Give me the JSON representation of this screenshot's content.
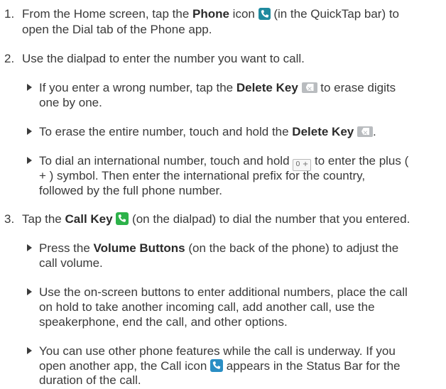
{
  "step1": {
    "num": "1.",
    "l1_a": "From the Home screen, tap the ",
    "l1_b": "Phone",
    "l1_c": " icon ",
    "l1_d": " (in the QuickTap bar) to",
    "l2": "open the Dial tab of the Phone app."
  },
  "step2": {
    "num": "2.",
    "l1": "Use the dialpad to enter the number you want to call.",
    "b1_l1_a": "If you enter a wrong number, tap the ",
    "b1_l1_b": "Delete Key",
    "b1_l1_c": " to erase digits",
    "b1_l2": "one by one.",
    "b2_a": "To erase the entire number, touch and hold the ",
    "b2_b": "Delete Key",
    "b2_c": ".",
    "b3_l1_a": "To dial an international number, touch and hold ",
    "b3_key": "0 +",
    "b3_l1_b": " to enter the plus (",
    "b3_l2": "+ ) symbol. Then enter the international prefix for the country,",
    "b3_l3": "followed by the full phone number."
  },
  "step3": {
    "num": "3.",
    "l1_a": "Tap the ",
    "l1_b": "Call Key",
    "l1_c": " (on the dialpad) to dial the number that you entered.",
    "b1_l1_a": "Press the ",
    "b1_l1_b": "Volume Buttons",
    "b1_l1_c": " (on the back of the phone) to adjust the",
    "b1_l2": "call volume.",
    "b2_l1": "Use the on-screen buttons to enter additional numbers, place the call",
    "b2_l2": "on hold to take another incoming call, add another call, use the",
    "b2_l3": "speakerphone, end the call, and other options.",
    "b3_l1": "You can use other phone features while the call is underway. If you",
    "b3_l2_a": "open another app, the Call icon ",
    "b3_l2_b": " appears in the Status Bar for the",
    "b3_l3": "duration of the call."
  },
  "icons": {
    "phone": "phone-icon",
    "delete": "delete-key-icon",
    "call": "call-key-icon",
    "zero_plus": "zero-plus-key-icon"
  },
  "colors": {
    "text": "#3a3a3a",
    "phone_icon": "#1f8a9f",
    "call_key": "#2db24a",
    "status_call_icon": "#2a8ec4",
    "delete_key": "#b9bcbf"
  }
}
